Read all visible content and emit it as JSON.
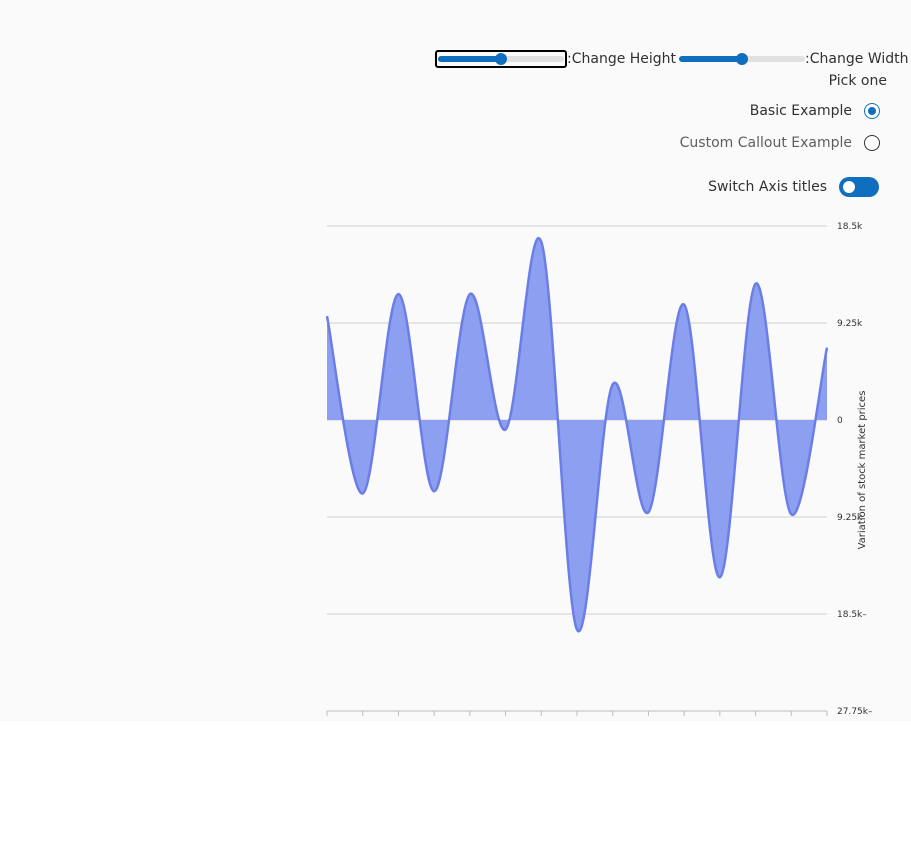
{
  "controls": {
    "height_slider_label": ":Change Height",
    "height_slider_value_pct": 50,
    "width_slider_label": ":Change Width",
    "width_slider_value_pct": 50,
    "radio_group_label": "Pick one",
    "radio_options": [
      {
        "label": "Basic Example",
        "checked": true
      },
      {
        "label": "Custom Callout Example",
        "checked": false
      }
    ],
    "toggle_label": "Switch Axis titles",
    "toggle_on": true
  },
  "colors": {
    "accent": "#106ebe",
    "area_fill": "#8d9ff0",
    "area_stroke": "#6b7ee6"
  },
  "chart_data": {
    "type": "area",
    "title": "",
    "ylabel": "Variation of stock market prices",
    "ylim": [
      -27750,
      18500
    ],
    "y_ticks": [
      18500,
      9250,
      0,
      -9250,
      -18500,
      -27750
    ],
    "y_tick_labels": [
      "18.5k",
      "9.25k",
      "0",
      "9.25k",
      "18.5k–",
      "27.75k–"
    ],
    "x_count": 15,
    "series": [
      {
        "values": [
          9900,
          -7000,
          12000,
          -6800,
          12000,
          -900,
          17000,
          -20000,
          3400,
          -8800,
          11000,
          -15000,
          13000,
          -9000,
          6900
        ]
      }
    ]
  }
}
